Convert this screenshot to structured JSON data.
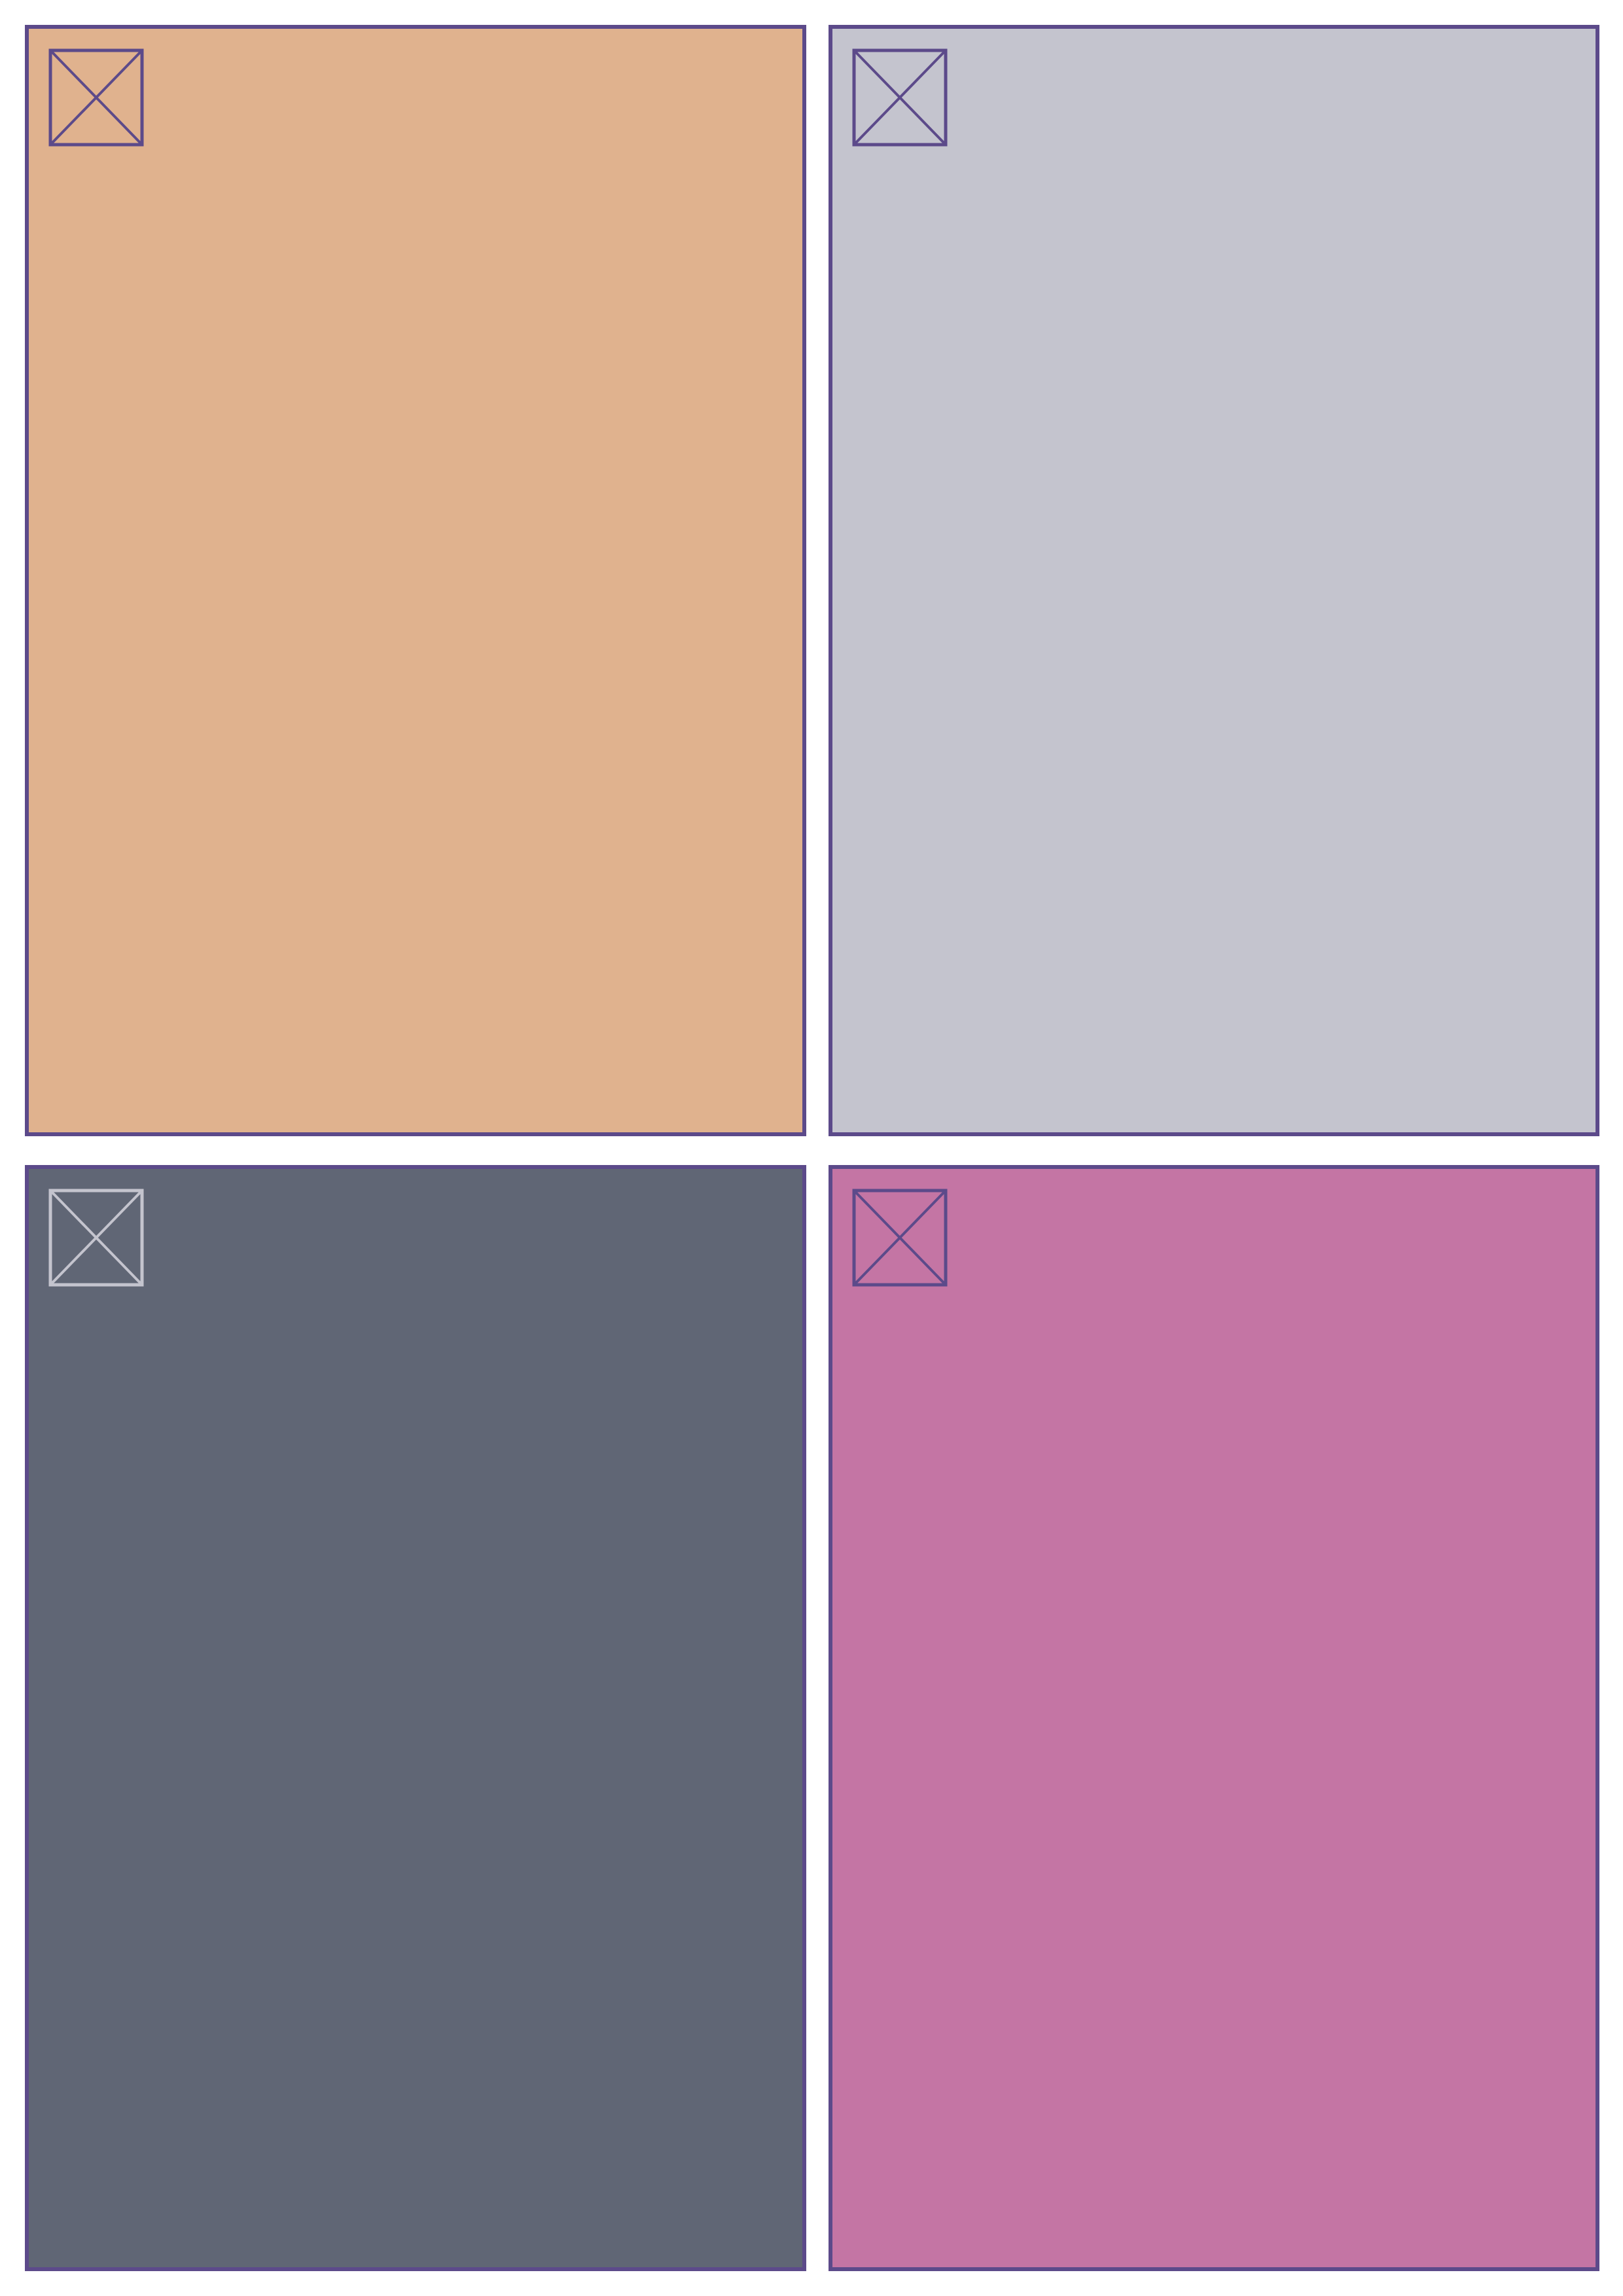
{
  "panels": [
    {
      "fill": "#e0b28e",
      "icon": "image-placeholder-icon",
      "icon_color": "#5c4a8a"
    },
    {
      "fill": "#c4c4ce",
      "icon": "image-placeholder-icon",
      "icon_color": "#5c4a8a"
    },
    {
      "fill": "#606675",
      "icon": "image-placeholder-icon",
      "icon_color": "#c4c4ce"
    },
    {
      "fill": "#c475a4",
      "icon": "image-placeholder-icon",
      "icon_color": "#5c4a8a"
    }
  ],
  "border_color": "#5c4a8a"
}
